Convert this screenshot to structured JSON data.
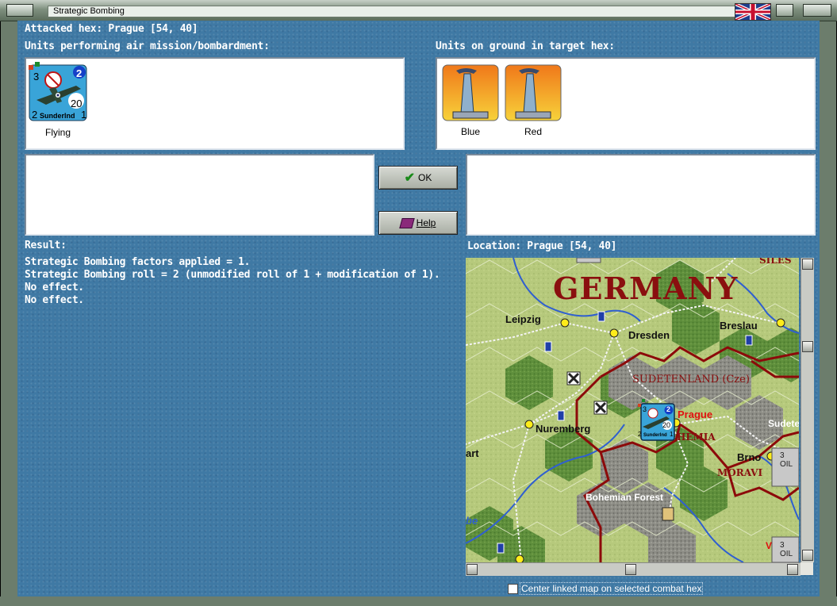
{
  "window": {
    "title": "Strategic Bombing"
  },
  "header": {
    "attacked_hex": "Attacked hex: Prague  [54, 40]",
    "attackers_label": "Units performing air mission/bombardment:",
    "defenders_label": "Units on ground in target hex:"
  },
  "attacker_units": [
    {
      "name": "Sunderlnd",
      "top_left": "3",
      "top_right": "2",
      "center": "20",
      "bottom_left": "2",
      "bottom_right": "1",
      "status": "Flying"
    }
  ],
  "defender_units": [
    {
      "name": "Blue"
    },
    {
      "name": "Red"
    }
  ],
  "buttons": {
    "ok_label": "OK",
    "help_label": "Help"
  },
  "result": {
    "label": "Result:",
    "lines": [
      "Strategic Bombing factors applied = 1.",
      "Strategic Bombing roll = 2 (unmodified roll of 1 + modification of 1).",
      "No effect.",
      "No effect."
    ]
  },
  "location": {
    "label": "Location:  Prague  [54, 40]"
  },
  "map": {
    "country": "GERMANY",
    "labels": {
      "sil": "SILES",
      "leipzig": "Leipzig",
      "dresden": "Dresden",
      "breslau": "Breslau",
      "sudetenland": "SUDETENLAND (Cze)",
      "prague": "Prague",
      "nuremberg": "Nuremberg",
      "bohemia": "HEMIA",
      "sudeten": "Sudete",
      "brno": "Brno",
      "moravia": "MORAVI",
      "bohemian_forest": "Bohemian Forest",
      "art": "art",
      "be": "be",
      "oil1": "3 OIL",
      "oil2": "3 OIL",
      "v": "V"
    },
    "unit": {
      "top_left": "3",
      "top_right": "2",
      "center": "20",
      "bottom_left": "2",
      "name": "Sunderlnd",
      "bottom_right": "1"
    }
  },
  "options": {
    "center_map_label": "Center linked map on selected combat hex",
    "center_map_checked": false
  },
  "colors": {
    "background": "#3f79a4",
    "border_red": "#8c0a0a",
    "country_label": "#8a0f0f"
  }
}
